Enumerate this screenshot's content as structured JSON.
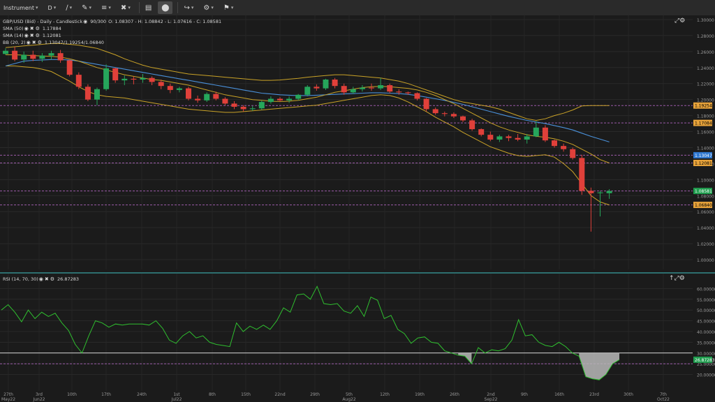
{
  "toolbar": {
    "items": [
      {
        "label": "Instrument",
        "icon": "chevron-down-icon"
      },
      {
        "label": "D",
        "icon": "chevron-down-icon"
      },
      {
        "label": "",
        "icon": "line-tool-icon"
      },
      {
        "label": "",
        "icon": "pencil-icon"
      },
      {
        "label": "",
        "icon": "fibonacci-icon"
      },
      {
        "label": "",
        "icon": "delete-icon"
      },
      {
        "label": "",
        "icon": "template-icon"
      },
      {
        "label": "",
        "icon": "fit-icon"
      },
      {
        "label": "",
        "icon": "share-icon"
      },
      {
        "label": "",
        "icon": "settings-icon"
      },
      {
        "label": "",
        "icon": "flag-uk-icon"
      }
    ]
  },
  "main": {
    "header": "GBP/USD (Bid) - Daily - Candlestick",
    "counter": "90/300",
    "ohlc": "O: 1.08307 - H: 1.08842 - L: 1.07616 - C: 1.08581",
    "indicators": [
      {
        "name": "SMA (50)",
        "value": "1.17884"
      },
      {
        "name": "SMA (14)",
        "value": "1.12081"
      },
      {
        "name": "BB (20, 2)",
        "value": "1.13047/1.19254/1.06840"
      }
    ],
    "colors": {
      "bull": "#26a65b",
      "bear": "#e0403a",
      "sma50": "#4a90d9",
      "sma14": "#c9a227",
      "bb": "#c9a227",
      "hline": "#9a5aa8"
    },
    "price_labels": [
      {
        "value": "1.19254",
        "bg": "#e8a33a",
        "fg": "#000000"
      },
      {
        "value": "1.17084",
        "bg": "#e8a33a",
        "fg": "#000000"
      },
      {
        "value": "1.13047",
        "bg": "#2f78d0",
        "fg": "#ffffff"
      },
      {
        "value": "1.12081",
        "bg": "#e8a33a",
        "fg": "#000000"
      },
      {
        "value": "1.08581",
        "bg": "#1f9d4e",
        "fg": "#ffffff"
      },
      {
        "value": "1.06840",
        "bg": "#e8a33a",
        "fg": "#000000"
      }
    ]
  },
  "rsi": {
    "header": "RSI (14, 70, 30)",
    "value": "26.87283",
    "label_value": "26.87283",
    "level_lines": [
      30,
      25
    ]
  },
  "chart_data": [
    {
      "type": "candlestick",
      "title": "GBP/USD (Bid) - Daily - Candlestick",
      "ylim": [
        1.0,
        1.3
      ],
      "yticks": [
        "1.30000",
        "1.28000",
        "1.26000",
        "1.24000",
        "1.22000",
        "1.20000",
        "1.18000",
        "1.16000",
        "1.14000",
        "1.12000",
        "1.10000",
        "1.08000",
        "1.06000",
        "1.04000",
        "1.02000",
        "1.00000"
      ],
      "xticks": [
        "27th May22",
        "3rd Jun22",
        "10th",
        "17th",
        "24th",
        "1st Jul22",
        "8th",
        "15th",
        "22nd",
        "29th",
        "5th Aug22",
        "12th",
        "19th",
        "26th",
        "2nd Sep22",
        "9th",
        "16th",
        "23rd",
        "30th",
        "7th Oct22"
      ],
      "horizontal_lines": [
        1.19254,
        1.17084,
        1.13047,
        1.12081,
        1.08581,
        1.0684
      ],
      "candles": [
        [
          1.257,
          1.264,
          1.256,
          1.261
        ],
        [
          1.261,
          1.266,
          1.248,
          1.25
        ],
        [
          1.25,
          1.26,
          1.246,
          1.256
        ],
        [
          1.256,
          1.261,
          1.248,
          1.251
        ],
        [
          1.251,
          1.258,
          1.247,
          1.255
        ],
        [
          1.255,
          1.261,
          1.25,
          1.258
        ],
        [
          1.258,
          1.262,
          1.246,
          1.249
        ],
        [
          1.249,
          1.25,
          1.229,
          1.231
        ],
        [
          1.231,
          1.234,
          1.213,
          1.216
        ],
        [
          1.216,
          1.219,
          1.198,
          1.2
        ],
        [
          1.2,
          1.215,
          1.193,
          1.213
        ],
        [
          1.213,
          1.244,
          1.211,
          1.239
        ],
        [
          1.239,
          1.24,
          1.221,
          1.224
        ],
        [
          1.224,
          1.23,
          1.218,
          1.226
        ],
        [
          1.226,
          1.229,
          1.219,
          1.225
        ],
        [
          1.225,
          1.232,
          1.221,
          1.227
        ],
        [
          1.227,
          1.229,
          1.218,
          1.222
        ],
        [
          1.222,
          1.225,
          1.213,
          1.217
        ],
        [
          1.217,
          1.22,
          1.208,
          1.212
        ],
        [
          1.212,
          1.216,
          1.209,
          1.214
        ],
        [
          1.214,
          1.216,
          1.199,
          1.201
        ],
        [
          1.201,
          1.205,
          1.196,
          1.199
        ],
        [
          1.199,
          1.209,
          1.197,
          1.207
        ],
        [
          1.207,
          1.21,
          1.199,
          1.201
        ],
        [
          1.201,
          1.203,
          1.193,
          1.195
        ],
        [
          1.195,
          1.198,
          1.188,
          1.191
        ],
        [
          1.191,
          1.193,
          1.185,
          1.188
        ],
        [
          1.188,
          1.192,
          1.186,
          1.189
        ],
        [
          1.189,
          1.199,
          1.187,
          1.197
        ],
        [
          1.197,
          1.204,
          1.195,
          1.201
        ],
        [
          1.201,
          1.203,
          1.197,
          1.199
        ],
        [
          1.199,
          1.204,
          1.196,
          1.201
        ],
        [
          1.201,
          1.207,
          1.199,
          1.206
        ],
        [
          1.206,
          1.218,
          1.204,
          1.216
        ],
        [
          1.216,
          1.219,
          1.211,
          1.214
        ],
        [
          1.214,
          1.226,
          1.212,
          1.225
        ],
        [
          1.225,
          1.227,
          1.214,
          1.217
        ],
        [
          1.217,
          1.22,
          1.206,
          1.209
        ],
        [
          1.209,
          1.216,
          1.207,
          1.213
        ],
        [
          1.213,
          1.218,
          1.21,
          1.215
        ],
        [
          1.215,
          1.22,
          1.211,
          1.214
        ],
        [
          1.214,
          1.227,
          1.212,
          1.218
        ],
        [
          1.218,
          1.22,
          1.208,
          1.21
        ],
        [
          1.21,
          1.213,
          1.206,
          1.209
        ],
        [
          1.209,
          1.21,
          1.206,
          1.208
        ],
        [
          1.208,
          1.209,
          1.199,
          1.201
        ],
        [
          1.201,
          1.202,
          1.185,
          1.188
        ],
        [
          1.188,
          1.19,
          1.181,
          1.183
        ],
        [
          1.183,
          1.185,
          1.179,
          1.182
        ],
        [
          1.182,
          1.184,
          1.177,
          1.179
        ],
        [
          1.179,
          1.18,
          1.172,
          1.174
        ],
        [
          1.174,
          1.176,
          1.161,
          1.163
        ],
        [
          1.163,
          1.164,
          1.154,
          1.156
        ],
        [
          1.156,
          1.16,
          1.148,
          1.15
        ],
        [
          1.15,
          1.156,
          1.147,
          1.154
        ],
        [
          1.154,
          1.156,
          1.148,
          1.152
        ],
        [
          1.152,
          1.157,
          1.148,
          1.15
        ],
        [
          1.15,
          1.157,
          1.145,
          1.154
        ],
        [
          1.154,
          1.173,
          1.153,
          1.165
        ],
        [
          1.165,
          1.168,
          1.147,
          1.149
        ],
        [
          1.149,
          1.15,
          1.14,
          1.142
        ],
        [
          1.142,
          1.145,
          1.135,
          1.138
        ],
        [
          1.138,
          1.14,
          1.125,
          1.127
        ],
        [
          1.127,
          1.131,
          1.081,
          1.086
        ],
        [
          1.086,
          1.09,
          1.035,
          1.083
        ],
        [
          1.083,
          1.086,
          1.054,
          1.084
        ],
        [
          1.083,
          1.088,
          1.076,
          1.0858
        ]
      ],
      "series": [
        {
          "name": "SMA (50)",
          "values": [
            1.242,
            1.245,
            1.248,
            1.249,
            1.2495,
            1.25,
            1.25,
            1.2495,
            1.248,
            1.246,
            1.244,
            1.242,
            1.24,
            1.238,
            1.236,
            1.234,
            1.232,
            1.23,
            1.228,
            1.226,
            1.224,
            1.222,
            1.22,
            1.218,
            1.216,
            1.214,
            1.212,
            1.21,
            1.208,
            1.207,
            1.206,
            1.2055,
            1.205,
            1.205,
            1.2055,
            1.206,
            1.2065,
            1.207,
            1.2075,
            1.208,
            1.2085,
            1.2085,
            1.208,
            1.2075,
            1.2065,
            1.205,
            1.203,
            1.201,
            1.199,
            1.1965,
            1.194,
            1.191,
            1.188,
            1.185,
            1.182,
            1.179,
            1.1765,
            1.174,
            1.172,
            1.17,
            1.1675,
            1.165,
            1.162,
            1.158,
            1.154,
            1.1505,
            1.147
          ]
        },
        {
          "name": "SMA (14)",
          "values": [
            1.256,
            1.256,
            1.2555,
            1.255,
            1.2545,
            1.254,
            1.253,
            1.251,
            1.248,
            1.244,
            1.24,
            1.237,
            1.234,
            1.231,
            1.229,
            1.227,
            1.225,
            1.224,
            1.222,
            1.22,
            1.218,
            1.215,
            1.212,
            1.209,
            1.206,
            1.204,
            1.202,
            1.2,
            1.199,
            1.198,
            1.1975,
            1.198,
            1.199,
            1.201,
            1.203,
            1.206,
            1.209,
            1.211,
            1.213,
            1.215,
            1.216,
            1.2165,
            1.216,
            1.215,
            1.214,
            1.212,
            1.209,
            1.205,
            1.2,
            1.195,
            1.189,
            1.183,
            1.177,
            1.171,
            1.166,
            1.162,
            1.159,
            1.156,
            1.154,
            1.153,
            1.151,
            1.148,
            1.144,
            1.138,
            1.132,
            1.125,
            1.1208
          ]
        },
        {
          "name": "BB upper",
          "values": [
            1.265,
            1.266,
            1.267,
            1.268,
            1.269,
            1.27,
            1.27,
            1.269,
            1.268,
            1.266,
            1.264,
            1.26,
            1.256,
            1.251,
            1.247,
            1.243,
            1.24,
            1.238,
            1.236,
            1.234,
            1.232,
            1.231,
            1.23,
            1.229,
            1.228,
            1.227,
            1.226,
            1.225,
            1.224,
            1.224,
            1.2245,
            1.2255,
            1.2265,
            1.228,
            1.229,
            1.23,
            1.231,
            1.231,
            1.23,
            1.229,
            1.228,
            1.227,
            1.225,
            1.223,
            1.22,
            1.216,
            1.212,
            1.208,
            1.204,
            1.2,
            1.197,
            1.195,
            1.193,
            1.191,
            1.188,
            1.184,
            1.18,
            1.176,
            1.174,
            1.176,
            1.18,
            1.183,
            1.187,
            1.192,
            1.1925,
            1.1925,
            1.1925
          ]
        },
        {
          "name": "BB lower",
          "values": [
            1.242,
            1.242,
            1.241,
            1.24,
            1.238,
            1.235,
            1.229,
            1.223,
            1.216,
            1.21,
            1.206,
            1.204,
            1.203,
            1.202,
            1.2,
            1.198,
            1.196,
            1.194,
            1.192,
            1.19,
            1.188,
            1.187,
            1.186,
            1.185,
            1.184,
            1.184,
            1.185,
            1.186,
            1.187,
            1.188,
            1.189,
            1.19,
            1.191,
            1.192,
            1.193,
            1.195,
            1.197,
            1.199,
            1.201,
            1.203,
            1.205,
            1.206,
            1.205,
            1.202,
            1.197,
            1.191,
            1.185,
            1.178,
            1.172,
            1.166,
            1.159,
            1.153,
            1.147,
            1.141,
            1.137,
            1.133,
            1.13,
            1.129,
            1.13,
            1.131,
            1.128,
            1.12,
            1.11,
            1.095,
            1.08,
            1.072,
            1.0684
          ]
        },
        {
          "name": "BB middle",
          "values": [
            1.2535,
            1.254,
            1.254,
            1.254,
            1.2535,
            1.2525,
            1.2495,
            1.246,
            1.242,
            1.238,
            1.235,
            1.232,
            1.2295,
            1.2265,
            1.2235,
            1.2205,
            1.218,
            1.216,
            1.214,
            1.212,
            1.21,
            1.209,
            1.208,
            1.207,
            1.206,
            1.2055,
            1.2055,
            1.2055,
            1.2055,
            1.206,
            1.2068,
            1.2078,
            1.2088,
            1.21,
            1.211,
            1.2125,
            1.214,
            1.215,
            1.2155,
            1.216,
            1.2165,
            1.2165,
            1.215,
            1.2125,
            1.2085,
            1.2035,
            1.1985,
            1.193,
            1.188,
            1.183,
            1.178,
            1.174,
            1.17,
            1.166,
            1.1625,
            1.1585,
            1.155,
            1.1525,
            1.152,
            1.1535,
            1.154,
            1.1515,
            1.1485,
            1.1435,
            1.1362,
            1.1322,
            1.1305
          ]
        }
      ]
    },
    {
      "type": "line",
      "title": "RSI (14, 70, 30)",
      "ylim": [
        15,
        65
      ],
      "yticks": [
        "60.00000",
        "55.00000",
        "50.00000",
        "45.00000",
        "40.00000",
        "35.00000",
        "30.00000",
        "25.00000",
        "20.00000"
      ],
      "series": [
        {
          "name": "RSI",
          "values": [
            50,
            52.5,
            49,
            44.5,
            50,
            46,
            49,
            47,
            48.5,
            44,
            40.5,
            34,
            30,
            38,
            45,
            44,
            42,
            43.5,
            43,
            43.5,
            43.5,
            43.5,
            43,
            45,
            41.5,
            36,
            34.5,
            38,
            40,
            37,
            38,
            35,
            34,
            33.5,
            33,
            44,
            40,
            42.5,
            41,
            43,
            41,
            45,
            51,
            49,
            57,
            57.5,
            55,
            61,
            53,
            52.5,
            53,
            49.5,
            48.5,
            52,
            47,
            56,
            54.5,
            46,
            47.5,
            41,
            39,
            34.5,
            37,
            37.5,
            35,
            34.5,
            31,
            30,
            29,
            28.5,
            25,
            32.5,
            30,
            31.5,
            31,
            32,
            36,
            45.5,
            38,
            38.5,
            35,
            33.5,
            33,
            35,
            33,
            30,
            28.5,
            19,
            18,
            17.5,
            20,
            25,
            26.87
          ]
        }
      ]
    }
  ]
}
